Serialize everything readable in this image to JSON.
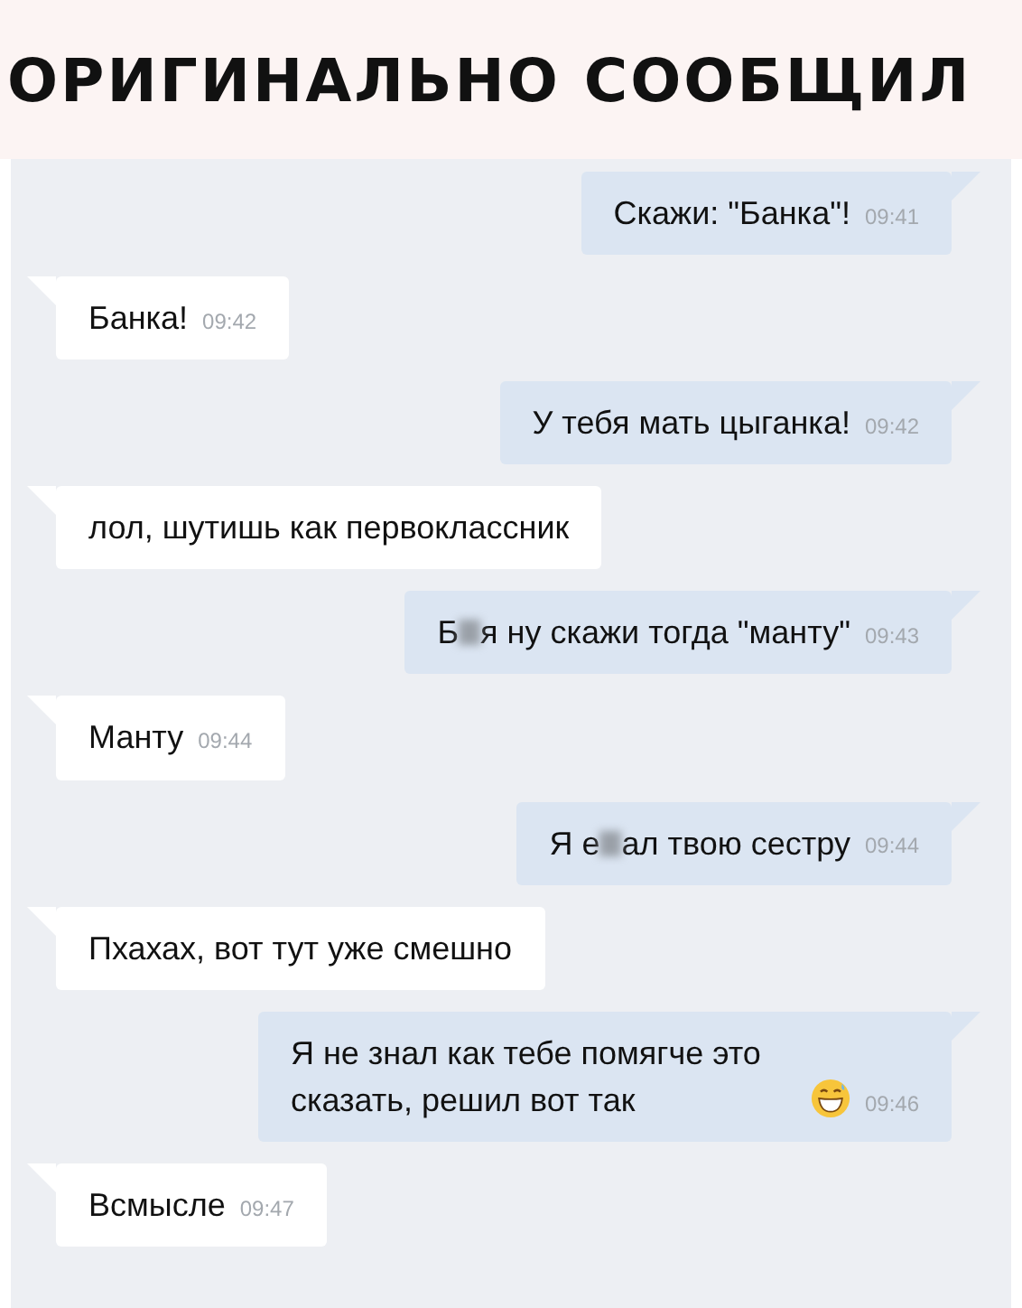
{
  "caption": "ОРИГИНАЛЬНО СООБЩИЛ",
  "messages": [
    {
      "sent": true,
      "parts": [
        {
          "kind": "text",
          "text": "Скажи: \"Банка\"!"
        }
      ],
      "time": "09:41"
    },
    {
      "sent": false,
      "parts": [
        {
          "kind": "text",
          "text": "Банка!"
        }
      ],
      "time": "09:42"
    },
    {
      "sent": true,
      "parts": [
        {
          "kind": "text",
          "text": "У тебя мать цыганка!"
        }
      ],
      "time": "09:42"
    },
    {
      "sent": false,
      "parts": [
        {
          "kind": "text",
          "text": "лол, шутишь как первоклассник"
        }
      ]
    },
    {
      "sent": true,
      "parts": [
        {
          "kind": "text",
          "text": "Б"
        },
        {
          "kind": "blur"
        },
        {
          "kind": "text",
          "text": "я ну скажи тогда \"манту\""
        }
      ],
      "time": "09:43"
    },
    {
      "sent": false,
      "parts": [
        {
          "kind": "text",
          "text": "Манту"
        }
      ],
      "time": "09:44"
    },
    {
      "sent": true,
      "parts": [
        {
          "kind": "text",
          "text": "Я е"
        },
        {
          "kind": "blur"
        },
        {
          "kind": "text",
          "text": "ал твою сестру"
        }
      ],
      "time": "09:44"
    },
    {
      "sent": false,
      "parts": [
        {
          "kind": "text",
          "text": "Пхахах, вот тут уже смешно"
        }
      ]
    },
    {
      "sent": true,
      "parts": [
        {
          "kind": "text",
          "text": "Я не знал как тебе помягче это сказать, решил вот так"
        },
        {
          "kind": "emoji"
        }
      ],
      "time": "09:46"
    },
    {
      "sent": false,
      "parts": [
        {
          "kind": "text",
          "text": "Всмысле"
        }
      ],
      "time": "09:47"
    }
  ]
}
